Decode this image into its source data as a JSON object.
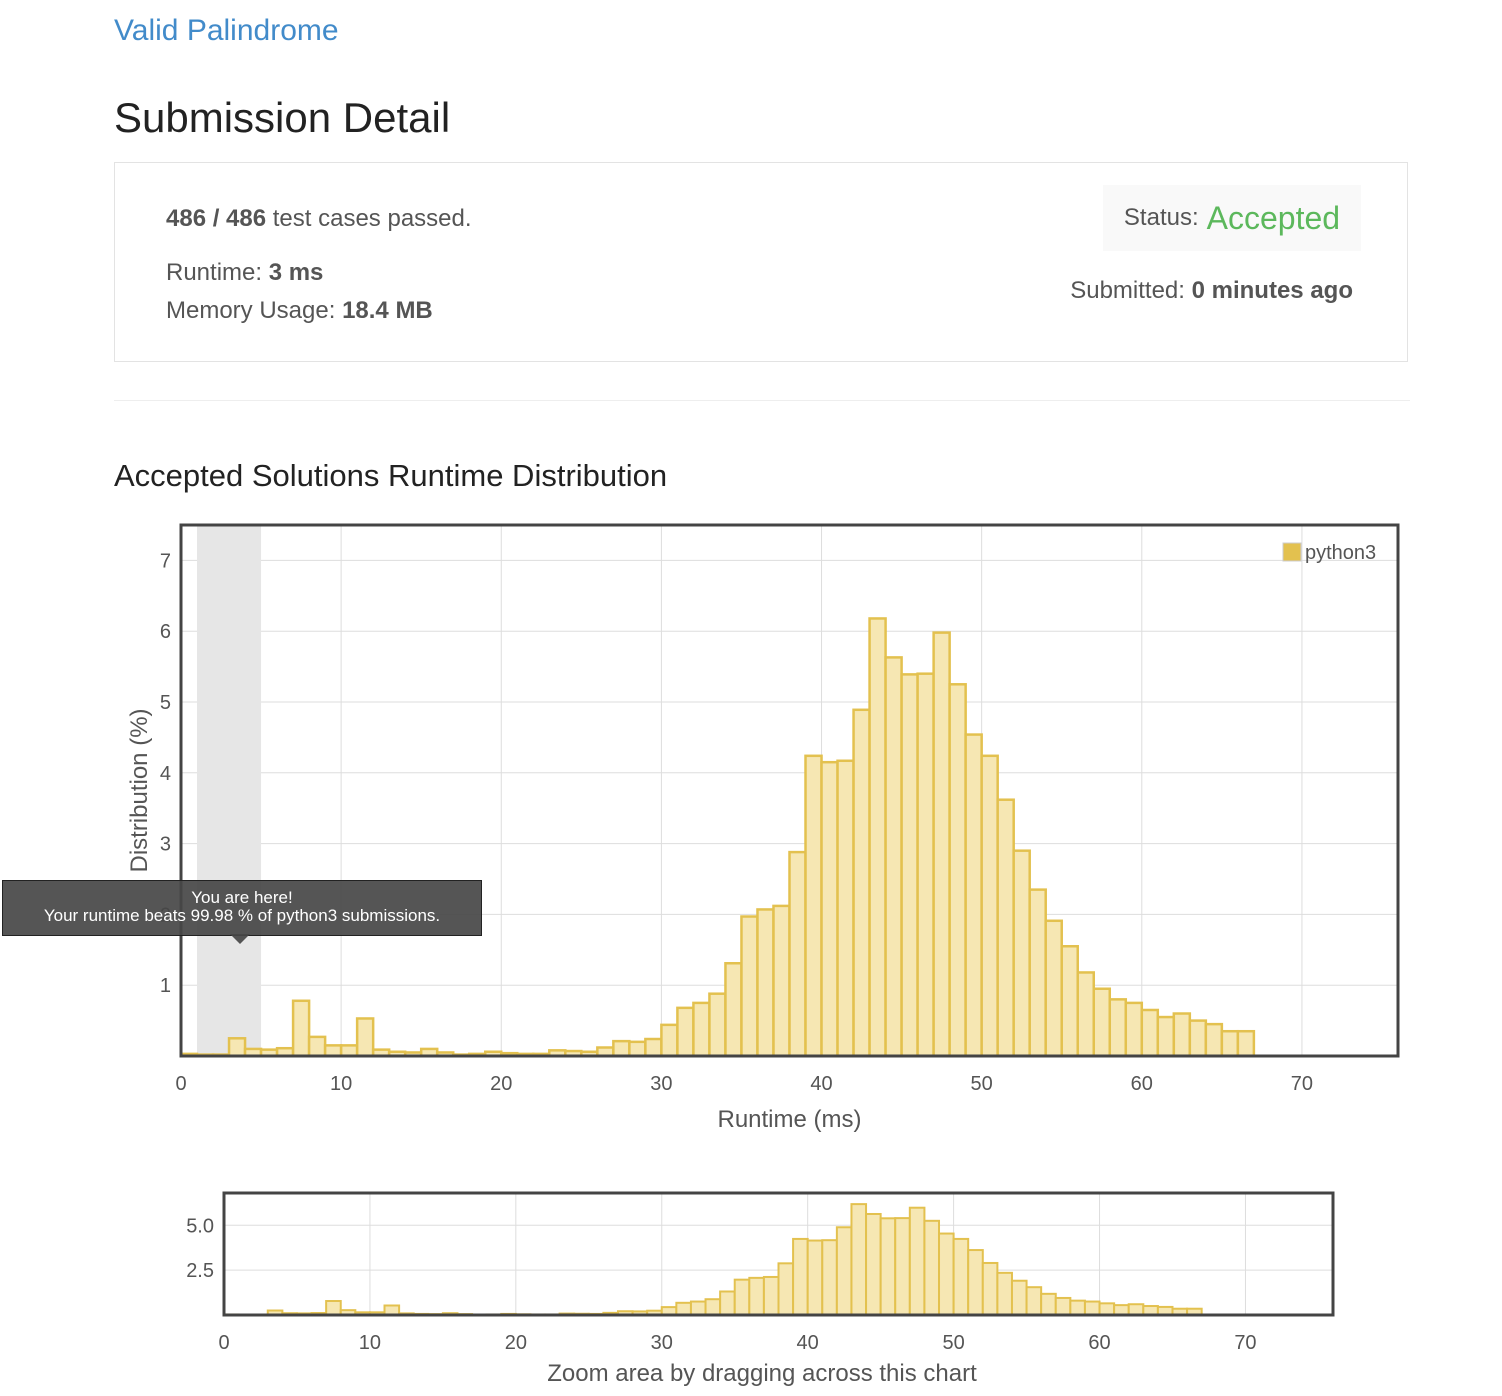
{
  "problem": {
    "title": "Valid Palindrome"
  },
  "page_title": "Submission Detail",
  "summary": {
    "passed": "486 / 486",
    "passed_suffix": " test cases passed.",
    "runtime_label": "Runtime: ",
    "runtime_value": "3 ms",
    "memory_label": "Memory Usage: ",
    "memory_value": "18.4 MB",
    "status_label": "Status:",
    "status_value": "Accepted",
    "submitted_label": "Submitted: ",
    "submitted_value": "0 minutes ago",
    "status_color": "#5cb85c"
  },
  "section_title": "Accepted Solutions Runtime Distribution",
  "tooltip": {
    "line1": "You are here!",
    "line2": "Your runtime beats 99.98 % of python3 submissions."
  },
  "zoom_hint": "Zoom area by dragging across this chart",
  "chart_data": [
    {
      "type": "bar",
      "xlabel": "Runtime (ms)",
      "ylabel": "Distribution (%)",
      "xlim": [
        0,
        76
      ],
      "ylim": [
        0,
        7.5
      ],
      "xticks": [
        0,
        10,
        20,
        30,
        40,
        50,
        60,
        70
      ],
      "yticks": [
        1,
        2,
        3,
        4,
        5,
        6,
        7
      ],
      "grid": true,
      "legend": "top-right",
      "highlight_range": [
        1,
        5
      ],
      "bar_color": "#f6e7b3",
      "bar_border": "#e3c14f",
      "series": [
        {
          "name": "python3",
          "x": [
            0,
            1,
            2,
            3,
            4,
            5,
            6,
            7,
            8,
            9,
            10,
            11,
            12,
            13,
            14,
            15,
            16,
            17,
            18,
            19,
            20,
            21,
            22,
            23,
            24,
            25,
            26,
            27,
            28,
            29,
            30,
            31,
            32,
            33,
            34,
            35,
            36,
            37,
            38,
            39,
            40,
            41,
            42,
            43,
            44,
            45,
            46,
            47,
            48,
            49,
            50,
            51,
            52,
            53,
            54,
            55,
            56,
            57,
            58,
            59,
            60,
            61,
            62,
            63,
            64,
            65,
            66
          ],
          "values": [
            0.03,
            0.02,
            0.02,
            0.25,
            0.1,
            0.09,
            0.11,
            0.78,
            0.27,
            0.15,
            0.15,
            0.53,
            0.09,
            0.06,
            0.05,
            0.1,
            0.05,
            0.02,
            0.03,
            0.06,
            0.04,
            0.03,
            0.03,
            0.08,
            0.07,
            0.06,
            0.12,
            0.21,
            0.2,
            0.24,
            0.44,
            0.68,
            0.75,
            0.88,
            1.31,
            1.97,
            2.07,
            2.12,
            2.88,
            4.24,
            4.15,
            4.17,
            4.89,
            6.18,
            5.63,
            5.39,
            5.4,
            5.98,
            5.25,
            4.54,
            4.24,
            3.62,
            2.9,
            2.35,
            1.91,
            1.55,
            1.18,
            0.95,
            0.8,
            0.75,
            0.65,
            0.55,
            0.6,
            0.5,
            0.45,
            0.35,
            0.35
          ]
        }
      ]
    },
    {
      "type": "bar",
      "xlim": [
        0,
        76
      ],
      "ylim": [
        0,
        6.8
      ],
      "xticks": [
        0,
        10,
        20,
        30,
        40,
        50,
        60,
        70
      ],
      "yticks": [
        2.5,
        5.0
      ],
      "ytick_labels": [
        "2.5",
        "5.0"
      ],
      "grid": true,
      "series_ref": "python3"
    }
  ]
}
